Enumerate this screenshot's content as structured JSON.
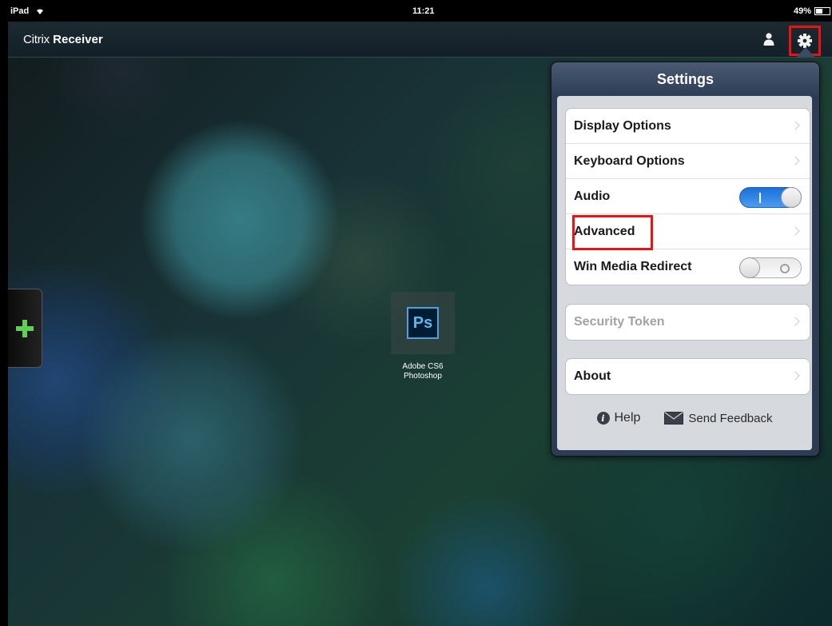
{
  "status_bar": {
    "device": "iPad",
    "time": "11:21",
    "battery": "49%"
  },
  "header": {
    "brand_prefix": "Citrix",
    "brand_name": "Receiver"
  },
  "app": {
    "icon_text": "Ps",
    "label_line1": "Adobe CS6",
    "label_line2": "Photoshop"
  },
  "settings": {
    "title": "Settings",
    "group1": [
      {
        "label": "Display Options",
        "type": "nav"
      },
      {
        "label": "Keyboard Options",
        "type": "nav"
      },
      {
        "label": "Audio",
        "type": "toggle",
        "on": true
      },
      {
        "label": "Advanced",
        "type": "nav"
      },
      {
        "label": "Win Media Redirect",
        "type": "toggle",
        "on": false
      }
    ],
    "security_token": "Security Token",
    "about": "About",
    "help": "Help",
    "send_feedback": "Send Feedback"
  },
  "colors": {
    "highlight": "#e11111",
    "toggle_on": "#2f80e6",
    "popover_frame": "#2c3c54"
  }
}
